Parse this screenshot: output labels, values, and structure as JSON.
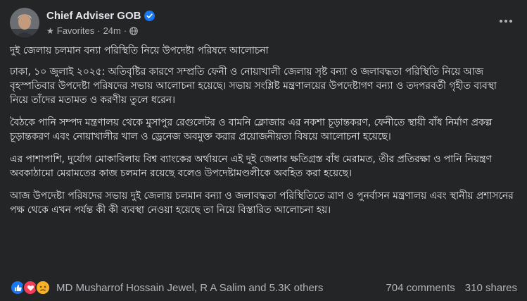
{
  "header": {
    "author": "Chief Adviser GOB",
    "audience_label": "Favorites",
    "time": "24m",
    "separator": "·",
    "privacy_icon": "globe-icon",
    "more_icon": "more-horizontal-icon"
  },
  "post": {
    "title": "দুই জেলায় চলমান বন্যা পরিস্থিতি নিয়ে উপদেষ্টা পরিষদে আলোচনা",
    "paragraphs": [
      "ঢাকা, ১০ জুলাই ২০২৫: অতিবৃষ্টির কারণে সম্প্রতি ফেনী ও নোয়াখালী জেলায় সৃষ্ট বন্যা ও জলাবদ্ধতা পরিস্থিতি নিয়ে আজ বৃহস্পতিবার উপদেষ্টা পরিষদের সভায় আলোচনা হয়েছে। সভায় সংশ্লিষ্ট মন্ত্রণালয়ের উপদেষ্টাগণ বন্যা ও তদপরবর্তী গৃহীত ব্যবস্থা নিয়ে তাঁদের মতামত ও করণীয় তুলে ধরেন।",
      "বৈঠকে পানি সম্পদ মন্ত্রণালয় থেকে মুসাপুর রেগুলেটর ও বামনি ক্লোজার এর নকশা চূড়ান্তকরণ, ফেনীতে স্থায়ী বাঁধ নির্মাণ প্রকল্প চূড়ান্তকরণ এবং নোয়াখালীর খাল ও ড্রেনেজ অবমুক্ত করার প্রয়োজনীয়তা বিষয়ে আলোচনা হয়েছে।",
      "এর পাশাপাশি, দুর্যোগ মোকাবিলায় বিশ্ব ব্যাংকের অর্থায়নে এই দুই জেলার ক্ষতিগ্রস্ত বাঁধ মেরামত, তীর প্রতিরক্ষা ও পানি নিয়ন্ত্রণ অবকাঠামো মেরামতের কাজ চলমান রয়েছে বলেও উপদেষ্টামণ্ডলীকে অবহিত করা হয়েছে।",
      "আজ উপদেষ্টা পরিষদের সভায় দুই জেলায় চলমান বন্যা ও জলাবদ্ধতা পরিস্থিতিতে ত্রাণ ও পুনর্বাসন মন্ত্রণালয় এবং স্থানীয় প্রশাসনের পক্ষ থেকে এখন পর্যন্ত কী কী ব্যবস্থা নেওয়া হয়েছে তা নিয়ে বিস্তারিত আলোচনা হয়।"
    ]
  },
  "footer": {
    "reaction_icons": [
      "like-icon",
      "love-icon",
      "sad-icon"
    ],
    "reactors": "MD Musharrof Hossain Jewel, R A Salim and 5.3K others",
    "comments": "704 comments",
    "shares": "310 shares"
  },
  "colors": {
    "background": "#242526",
    "text": "#e4e6eb",
    "secondary": "#b0b3b8",
    "verified": "#1877f2",
    "like": "#1877f2",
    "love": "#f33e58",
    "sad": "#f7b125"
  }
}
